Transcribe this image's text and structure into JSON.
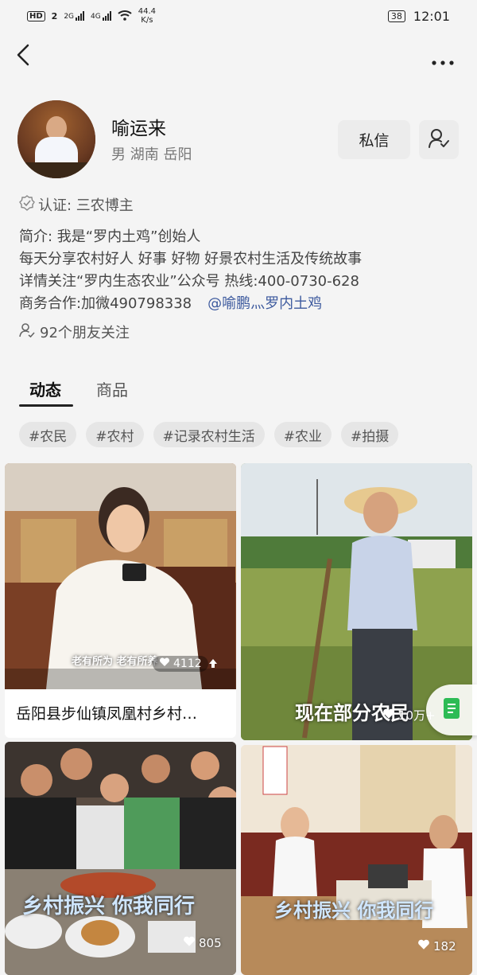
{
  "status_bar": {
    "hd": "HD",
    "sim": "2",
    "net1": "2G",
    "net2": "4G",
    "speed_value": "44.4",
    "speed_unit": "K/s",
    "battery": "38",
    "time": "12:01"
  },
  "profile": {
    "name": "喻运来",
    "meta": "男  湖南 岳阳",
    "message_button": "私信",
    "verification": "认证: 三农博主",
    "bio_lines": [
      "简介: 我是“罗内土鸡”创始人",
      "每天分享农村好人 好事  好物  好景农村生活及传统故事",
      "详情关注“罗内生态农业”公众号 热线:400-0730-628",
      "商务合作:加微490798338"
    ],
    "mention": "@喻鹏灬罗内土鸡",
    "friends_following": "92个朋友关注"
  },
  "tabs": [
    {
      "label": "动态",
      "active": true
    },
    {
      "label": "商品",
      "active": false
    }
  ],
  "hashtags": [
    "#农民",
    "#农村",
    "#记录农村生活",
    "#农业",
    "#拍摄"
  ],
  "feed": [
    {
      "title": "岳阳县步仙镇凤凰村乡村…",
      "caption": "老有所为  老有所养",
      "likes": "4112"
    },
    {
      "title": "",
      "caption": "现在部分农民",
      "likes": "10万+"
    },
    {
      "title": "",
      "caption": "乡村振兴 你我同行",
      "likes": "805"
    },
    {
      "title": "",
      "caption": "乡村振兴 你我同行",
      "likes": "182"
    }
  ],
  "colors": {
    "background": "#f4f4f4",
    "mention": "#3d5a9e",
    "button_bg": "#ececec",
    "floating_icon": "#2dbb55"
  },
  "icons": [
    "back-icon",
    "more-icon",
    "follow-user-icon",
    "verified-icon",
    "friends-icon",
    "heart-icon",
    "share-icon",
    "document-icon"
  ]
}
